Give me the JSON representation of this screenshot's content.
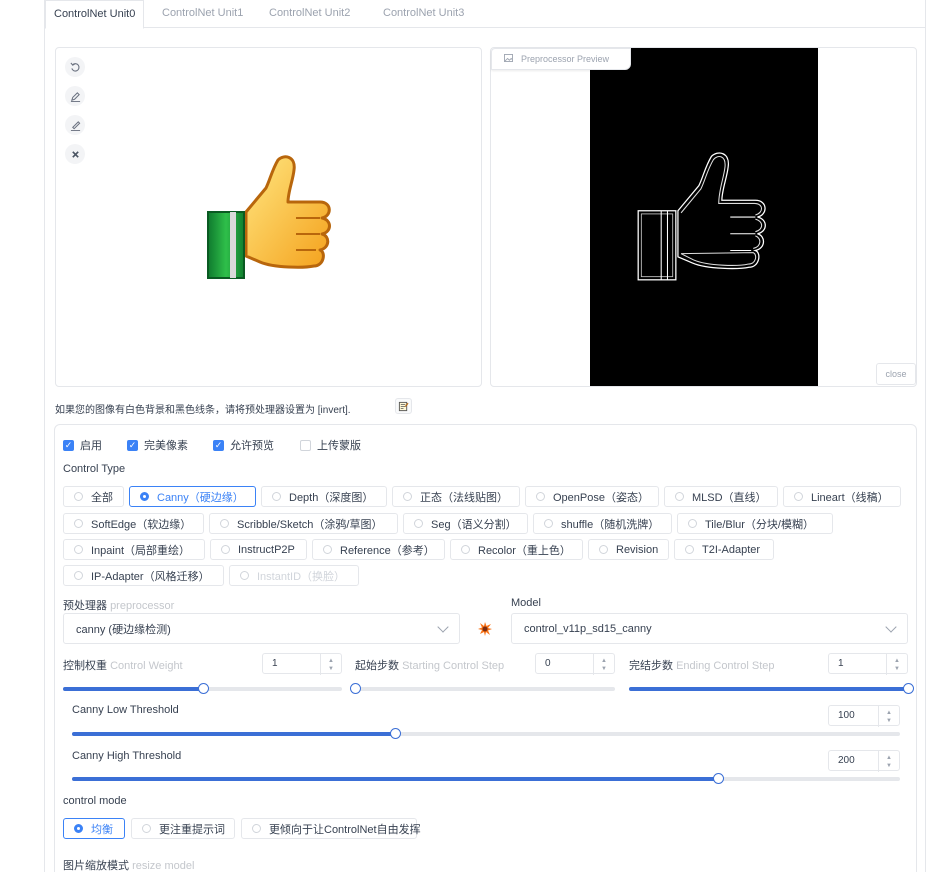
{
  "tabs": [
    "ControlNet Unit0",
    "ControlNet Unit1",
    "ControlNet Unit2",
    "ControlNet Unit3"
  ],
  "preview": {
    "label": "Preprocessor Preview",
    "close": "close"
  },
  "hint": {
    "text": "如果您的图像有白色背景和黑色线条，请将预处理器设置为 [invert]."
  },
  "checks": [
    {
      "label": "启用",
      "checked": true
    },
    {
      "label": "完美像素",
      "checked": true
    },
    {
      "label": "允许预览",
      "checked": true
    },
    {
      "label": "上传蒙版",
      "checked": false
    }
  ],
  "control_type": {
    "label": "Control Type",
    "options": [
      "全部",
      "Canny（硬边缘）",
      "Depth（深度图）",
      "正态（法线贴图）",
      "OpenPose（姿态）",
      "MLSD（直线）",
      "Lineart（线稿）",
      "SoftEdge（软边缘）",
      "Scribble/Sketch（涂鸦/草图）",
      "Seg（语义分割）",
      "shuffle（随机洗牌）",
      "Tile/Blur（分块/模糊）",
      "Inpaint（局部重绘）",
      "InstructP2P",
      "Reference（参考）",
      "Recolor（重上色）",
      "Revision",
      "T2I-Adapter",
      "IP-Adapter（风格迁移）",
      "InstantID（换脸）"
    ],
    "selected": "Canny（硬边缘）"
  },
  "preprocessor": {
    "label": "预处理器",
    "sub": "preprocessor",
    "value": "canny (硬边缘检测)"
  },
  "model": {
    "label": "Model",
    "value": "control_v11p_sd15_canny"
  },
  "weight": {
    "label": "控制权重",
    "sub": "Control Weight",
    "value": "1",
    "fraction": 0.5
  },
  "start_step": {
    "label": "起始步数",
    "sub": "Starting Control Step",
    "value": "0",
    "fraction": 0
  },
  "end_step": {
    "label": "完结步数",
    "sub": "Ending Control Step",
    "value": "1",
    "fraction": 1
  },
  "canny_low": {
    "label": "Canny Low Threshold",
    "value": "100",
    "fraction": 0.39
  },
  "canny_high": {
    "label": "Canny High Threshold",
    "value": "200",
    "fraction": 0.78
  },
  "control_mode": {
    "label": "control mode",
    "options": [
      "均衡",
      "更注重提示词",
      "更倾向于让ControlNet自由发挥"
    ],
    "selected": "均衡"
  },
  "resize_mode": {
    "label": "图片缩放模式",
    "sub": "resize model"
  },
  "colors": {
    "accent": "#3b82f6",
    "slider": "#3b6fd6",
    "preview_bg": "#000000"
  }
}
